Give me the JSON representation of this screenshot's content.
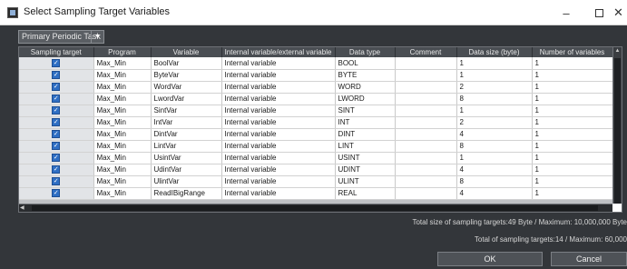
{
  "window": {
    "title": "Select Sampling Target Variables",
    "min_glyph": "–",
    "close_glyph": "✕"
  },
  "task_select": {
    "value": "Primary Periodic Task",
    "arrow": "▼"
  },
  "table": {
    "headers": [
      "Sampling target",
      "Program",
      "Variable",
      "Internal variable/external variable",
      "Data type",
      "Comment",
      "Data size (byte)",
      "Number of variables"
    ],
    "rows": [
      {
        "checked": true,
        "program": "Max_Min",
        "variable": "BoolVar",
        "kind": "Internal variable",
        "type": "BOOL",
        "comment": "",
        "size": "1",
        "count": "1"
      },
      {
        "checked": true,
        "program": "Max_Min",
        "variable": "ByteVar",
        "kind": "Internal variable",
        "type": "BYTE",
        "comment": "",
        "size": "1",
        "count": "1"
      },
      {
        "checked": true,
        "program": "Max_Min",
        "variable": "WordVar",
        "kind": "Internal variable",
        "type": "WORD",
        "comment": "",
        "size": "2",
        "count": "1"
      },
      {
        "checked": true,
        "program": "Max_Min",
        "variable": "LwordVar",
        "kind": "Internal variable",
        "type": "LWORD",
        "comment": "",
        "size": "8",
        "count": "1"
      },
      {
        "checked": true,
        "program": "Max_Min",
        "variable": "SintVar",
        "kind": "Internal variable",
        "type": "SINT",
        "comment": "",
        "size": "1",
        "count": "1"
      },
      {
        "checked": true,
        "program": "Max_Min",
        "variable": "IntVar",
        "kind": "Internal variable",
        "type": "INT",
        "comment": "",
        "size": "2",
        "count": "1"
      },
      {
        "checked": true,
        "program": "Max_Min",
        "variable": "DintVar",
        "kind": "Internal variable",
        "type": "DINT",
        "comment": "",
        "size": "4",
        "count": "1"
      },
      {
        "checked": true,
        "program": "Max_Min",
        "variable": "LintVar",
        "kind": "Internal variable",
        "type": "LINT",
        "comment": "",
        "size": "8",
        "count": "1"
      },
      {
        "checked": true,
        "program": "Max_Min",
        "variable": "UsintVar",
        "kind": "Internal variable",
        "type": "USINT",
        "comment": "",
        "size": "1",
        "count": "1"
      },
      {
        "checked": true,
        "program": "Max_Min",
        "variable": "UdintVar",
        "kind": "Internal variable",
        "type": "UDINT",
        "comment": "",
        "size": "4",
        "count": "1"
      },
      {
        "checked": true,
        "program": "Max_Min",
        "variable": "UlintVar",
        "kind": "Internal variable",
        "type": "ULINT",
        "comment": "",
        "size": "8",
        "count": "1"
      },
      {
        "checked": true,
        "program": "Max_Min",
        "variable": "ReadIBigRange",
        "kind": "Internal variable",
        "type": "REAL",
        "comment": "",
        "size": "4",
        "count": "1"
      }
    ]
  },
  "summary": {
    "total_size": "Total size of sampling targets:49 Byte / Maximum: 10,000,000 Byte",
    "total_count": "Total of sampling targets:14 / Maximum: 60,000"
  },
  "buttons": {
    "ok": "OK",
    "cancel": "Cancel"
  },
  "colors": {
    "checkbox": "#2f6fc4",
    "dialog_bg": "#33363a",
    "header_bg": "#4a4e53"
  }
}
